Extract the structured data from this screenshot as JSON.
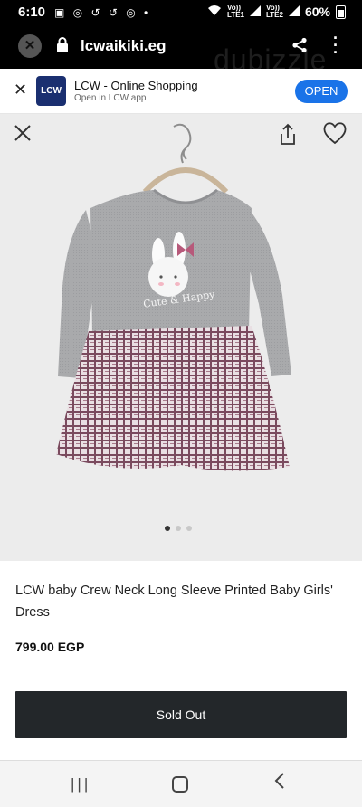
{
  "status_bar": {
    "time": "6:10",
    "notification_icons": "▣ ◎ ↺ ↺ ◎ •",
    "network_1": "Vo))\nLTE1",
    "network_2": "Vo))\nLTE2",
    "battery": "60%"
  },
  "browser": {
    "url": "lcwaikiki.eg",
    "watermark": "dubizzle"
  },
  "app_banner": {
    "logo_text": "LCW",
    "title": "LCW - Online Shopping",
    "subtitle": "Open in LCW app",
    "open_label": "OPEN"
  },
  "product": {
    "name": "LCW baby Crew Neck Long Sleeve Printed Baby Girls' Dress",
    "price": "799.00 EGP",
    "print_text": "Cute & Happy",
    "button_label": "Sold Out",
    "carousel_total": 3,
    "carousel_active": 1
  },
  "colors": {
    "topbar": "#000000",
    "open_button": "#1a73e8",
    "sold_out_button": "#23272a",
    "dress_grey": "#a9aaac",
    "skirt_plaid": "#8a5a6e"
  }
}
